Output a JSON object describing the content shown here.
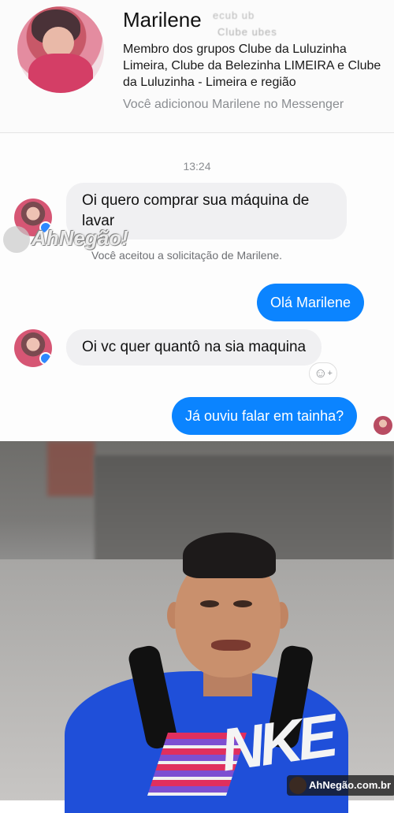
{
  "contact": {
    "name": "Marilene",
    "name_ghost": "ecub   ub  ",
    "name_ghost2": "Clube   ubes  ",
    "groups": "Membro dos grupos Clube da Luluzinha Limeira, Clube da Belezinha LIMEIRA e Clube da Luluzinha - Limeira e região",
    "added_text": "Você adicionou Marilene no Messenger"
  },
  "conversation": {
    "timestamp": "13:24",
    "notice": "Você aceitou a solicitação de Marilene.",
    "messages": [
      {
        "from": "them",
        "text": "Oi quero comprar sua máquina de lavar"
      },
      {
        "from": "me",
        "text": "Olá Marilene"
      },
      {
        "from": "them",
        "text": "Oi vc quer quantô na sia maquina"
      },
      {
        "from": "me",
        "text": "Já ouviu falar em tainha?"
      }
    ],
    "react_icon": "smiley-plus-icon",
    "accent_color": "#0b84ff"
  },
  "watermarks": {
    "top": "AhNegão!",
    "bottom": "AhNegão.com.br"
  },
  "photo": {
    "shirt_logo": "NKE"
  }
}
